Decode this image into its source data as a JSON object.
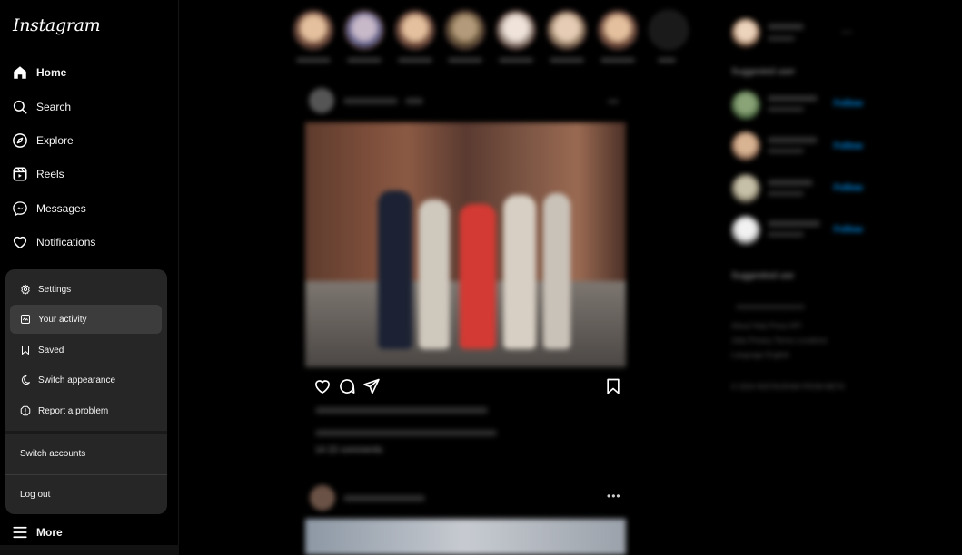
{
  "app": {
    "logo_text": "Instagram"
  },
  "sidebar": {
    "items": [
      {
        "label": "Home",
        "icon": "home-icon",
        "active": true
      },
      {
        "label": "Search",
        "icon": "search-icon"
      },
      {
        "label": "Explore",
        "icon": "compass-icon"
      },
      {
        "label": "Reels",
        "icon": "reels-icon"
      },
      {
        "label": "Messages",
        "icon": "messenger-icon"
      },
      {
        "label": "Notifications",
        "icon": "heart-icon"
      }
    ],
    "more_label": "More"
  },
  "more_menu": {
    "items": [
      {
        "label": "Settings",
        "icon": "gear-icon"
      },
      {
        "label": "Your activity",
        "icon": "activity-icon",
        "highlighted": true
      },
      {
        "label": "Saved",
        "icon": "bookmark-icon"
      },
      {
        "label": "Switch appearance",
        "icon": "moon-icon"
      },
      {
        "label": "Report a problem",
        "icon": "report-icon"
      }
    ],
    "switch_accounts_label": "Switch accounts",
    "logout_label": "Log out"
  },
  "feed": {
    "comments_text": "14 22 comments",
    "more_dots": "•••"
  },
  "right_column": {
    "suggested_heading_1": "Suggested user",
    "suggested_heading_2": "Suggestiod use",
    "follow_label": "Follow",
    "more_dots": "•••",
    "footer_links_1": "About  Help  Press  API",
    "footer_links_2": "Jobs  Privacy  Terms  Locations",
    "footer_links_3": "Language  English",
    "copyright": "© 2024 INSTAGRAM FROM META"
  },
  "colors": {
    "background": "#000000",
    "menu_background": "#262626",
    "menu_highlight": "#3c3c3c",
    "follow_blue": "#0095f6"
  }
}
